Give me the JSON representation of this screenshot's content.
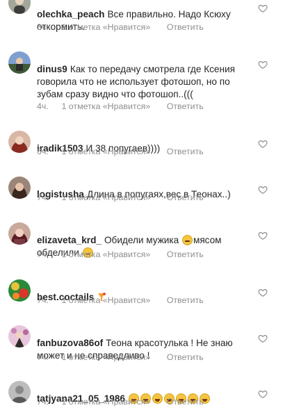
{
  "comments": [
    {
      "username": "olechka_peach",
      "text": "Все правильно. Надо Ксюху откормить.",
      "time": "3ч.",
      "likes": "1 отметка «Нравится»",
      "reply": "Ответить",
      "avatar_color": "#a3a79a"
    },
    {
      "username": "dinus9",
      "text": "Как то передачу смотрела где Ксения говорила что не использует фотошоп, но по зубам сразу видно что фотошоп..(((",
      "time": "4ч.",
      "likes": "1 отметка «Нравится»",
      "reply": "Ответить",
      "avatar_color": "#5a7bb3"
    },
    {
      "username": "iradik1503",
      "text": "И 38 попугаев))))",
      "time": "6ч.",
      "likes": "1 отметка «Нравится»",
      "reply": "Ответить",
      "avatar_color": "#b35a4d"
    },
    {
      "username": "logistusha",
      "text": "Длина в попугаях,вес в Теонах..)",
      "time": "7ч.",
      "likes": "1 отметка «Нравится»",
      "reply": "Ответить",
      "avatar_color": "#6b4a3e"
    },
    {
      "username": "elizaveta_krd_",
      "text_parts": [
        "Обидели мужика ",
        "мясом обделили "
      ],
      "time": "7ч.",
      "likes": "1 отметка «Нравится»",
      "reply": "Ответить",
      "avatar_color": "#7a3a43"
    },
    {
      "username": "best.coctails",
      "text": "",
      "time": "7ч.",
      "likes": "1 отметка «Нравится»",
      "reply": "Ответить",
      "avatar_color": "#c23a2a"
    },
    {
      "username": "fanbuzova86of",
      "text": "Теона красотулька ! Не знаю может и не справедливо !",
      "time": "7ч.",
      "likes": "1 отметка «Нравится»",
      "reply": "Ответить",
      "avatar_color": "#c884b5"
    },
    {
      "username": "tatjyana21_05_1986",
      "text": "",
      "time": "7ч.",
      "likes": "1 отметка «Нравится»",
      "reply": "Ответить",
      "avatar_color": "#6f6f6f"
    }
  ],
  "icons": {
    "like": "heart-outline-icon",
    "emoji_laugh": "face-with-tears-of-joy-icon",
    "emoji_grin": "grinning-face-icon",
    "emoji_think": "thinking-face-icon",
    "cocktail": "tropical-drink-icon"
  },
  "colors": {
    "text": "#262626",
    "meta": "#8e8e8e",
    "heart": "#8e8e8e"
  }
}
